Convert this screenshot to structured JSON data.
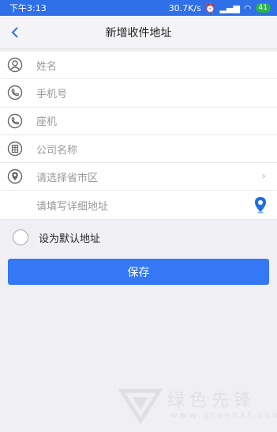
{
  "status_bar": {
    "time": "下午3:13",
    "net_speed": "30.7K/s",
    "battery": "41"
  },
  "nav": {
    "title": "新增收件地址"
  },
  "form": {
    "name_placeholder": "姓名",
    "mobile_placeholder": "手机号",
    "landline_placeholder": "座机",
    "company_placeholder": "公司名称",
    "region_placeholder": "请选择省市区",
    "address_placeholder": "请填写详细地址"
  },
  "default_option": {
    "label": "设为默认地址",
    "checked": false
  },
  "save_button": {
    "label": "保存"
  },
  "watermark": {
    "text": "绿色先锋",
    "url": "www.greenxf.com"
  },
  "colors": {
    "accent": "#3478f6",
    "status_bar": "#2f6fe8",
    "background": "#f0f0f4"
  }
}
